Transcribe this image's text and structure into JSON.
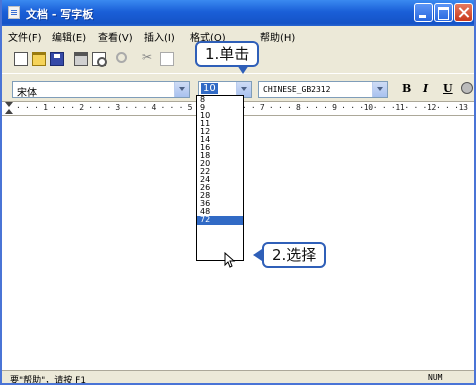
{
  "window": {
    "title": "文档 - 写字板"
  },
  "menu": {
    "items": [
      "文件(F)",
      "编辑(E)",
      "查看(V)",
      "插入(I)",
      "格式(O)",
      "帮助(H)"
    ]
  },
  "toolbar": {
    "icons": [
      "new-icon",
      "open-icon",
      "save-icon",
      "print-icon",
      "print-preview-icon",
      "find-icon",
      "cut-icon",
      "copy-icon"
    ]
  },
  "format": {
    "font": "宋体",
    "size": "10",
    "script": "CHINESE_GB2312",
    "bold": "B",
    "italic": "I",
    "underline": "U"
  },
  "ruler": {
    "text": "· · · 1 · · · 2 · · · 3 · · · 4 · · · 5 · · · 6 · · · 7 · · · 8 · · · 9 · · ·10· · ·11· · ·12· · ·13"
  },
  "font_size_options": [
    "8",
    "9",
    "10",
    "11",
    "12",
    "14",
    "16",
    "18",
    "20",
    "22",
    "24",
    "26",
    "28",
    "36",
    "48",
    "72"
  ],
  "font_size_selected": "72",
  "callouts": {
    "step1": "1.单击",
    "step2": "2.选择"
  },
  "status": {
    "help": "要\"帮助\"，请按 F1",
    "num": "NUM"
  },
  "colors": {
    "titlebar": "#1a5fd8",
    "selection": "#316ac5",
    "callout_border": "#2f5fb8",
    "chrome": "#ece9d8"
  }
}
